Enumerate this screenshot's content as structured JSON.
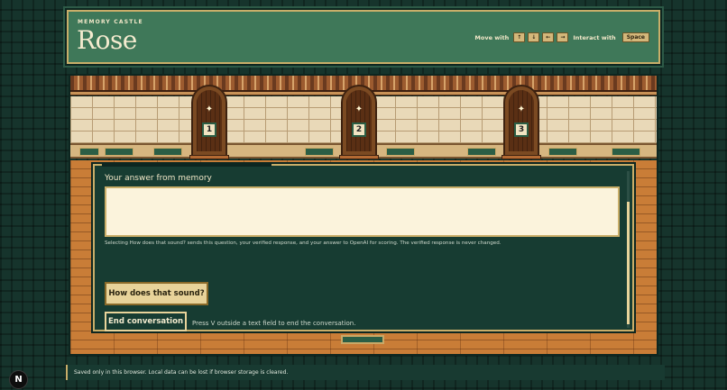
{
  "header": {
    "eyebrow": "MEMORY CASTLE",
    "title": "Rose",
    "move_label": "Move with",
    "move_keys": [
      "↑",
      "↓",
      "←",
      "→"
    ],
    "interact_label": "Interact with",
    "interact_key": "Space"
  },
  "scene": {
    "doors": [
      {
        "number": "1",
        "icon": "sparkle-icon"
      },
      {
        "number": "2",
        "icon": "sparkle-icon"
      },
      {
        "number": "3",
        "icon": "sparkle-icon"
      }
    ]
  },
  "dialog": {
    "heading": "Your answer from memory",
    "answer_value": "",
    "note": "Selecting How does that sound? sends this question, your verified response, and your answer to OpenAI for scoring. The verified response is never changed.",
    "submit_label": "How does that sound?",
    "end_label": "End conversation",
    "end_hint": "Press V outside a text field to end the conversation."
  },
  "footer": {
    "saved_text": "Saved only in this browser. Local data can be lost if browser storage is cleared.",
    "badge": "N"
  }
}
